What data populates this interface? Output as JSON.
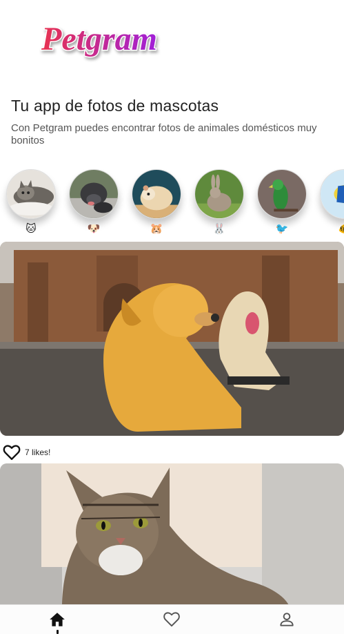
{
  "app": {
    "logo_text": "Petgram"
  },
  "header": {
    "title": "Tu app de fotos de mascotas",
    "subtitle": "Con Petgram puedes encontrar fotos de animales domésticos muy bonitos"
  },
  "categories": [
    {
      "name": "cats",
      "emoji": "🐱"
    },
    {
      "name": "dogs",
      "emoji": "🐶"
    },
    {
      "name": "hamsters",
      "emoji": "🐹"
    },
    {
      "name": "rabbits",
      "emoji": "🐰"
    },
    {
      "name": "birds",
      "emoji": "🐦"
    },
    {
      "name": "fish",
      "emoji": "🐠"
    }
  ],
  "feed": [
    {
      "likes_label": "7 likes!"
    },
    {
      "likes_label": ""
    }
  ],
  "navbar": {
    "items": [
      "home-icon",
      "heart-icon",
      "user-icon"
    ],
    "active_index": 0
  },
  "colors": {
    "logo_gradient_start": "#e8334f",
    "logo_gradient_end": "#a020d8",
    "accent": "#111111"
  }
}
